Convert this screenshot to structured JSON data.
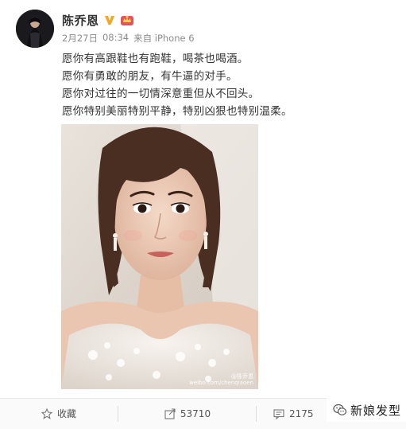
{
  "author": {
    "name": "陈乔恩",
    "verified_icon": "verified-v-icon",
    "vip_icon": "vip-crown-icon"
  },
  "meta": {
    "date": "2月27日",
    "time": "08:34",
    "source": "来自 iPhone 6"
  },
  "post": {
    "lines": [
      "愿你有高跟鞋也有跑鞋，喝茶也喝酒。",
      "愿你有勇敢的朋友，有牛逼的对手。",
      "愿你对过往的一切情深意重但从不回头。",
      "愿你特别美丽特别平静，特别凶狠也特别温柔。"
    ]
  },
  "photo": {
    "watermark_name": "@陈乔恩",
    "watermark_url": "weibo.com/chenqiaoen"
  },
  "actions": {
    "favorite_label": "收藏",
    "share_count": "53710",
    "comment_count": "2175"
  },
  "brand": {
    "text": "新娘发型"
  },
  "colors": {
    "verified": "#f5a623",
    "vip": "#e8505b",
    "text": "#333333",
    "meta": "#8c8c8c"
  }
}
